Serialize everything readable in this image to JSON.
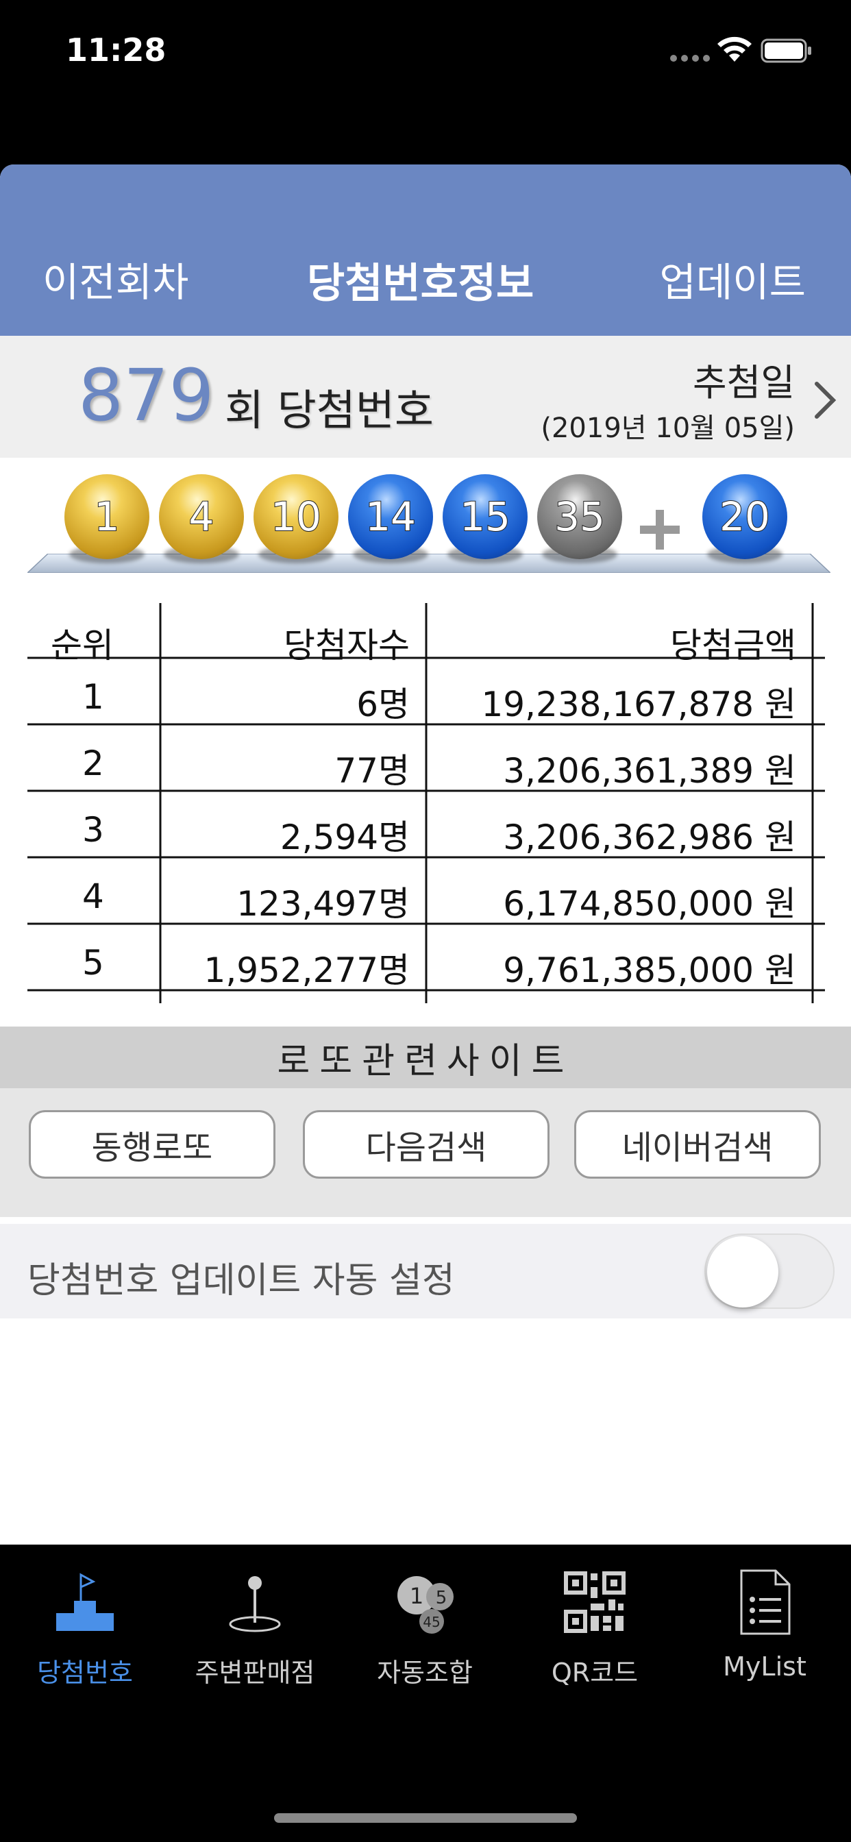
{
  "status": {
    "time": "11:28"
  },
  "nav": {
    "prev": "이전회차",
    "title": "당첨번호정보",
    "update": "업데이트"
  },
  "round": {
    "number": "879",
    "label": "회 당첨번호",
    "draw_label": "추첨일",
    "draw_date": "(2019년 10월 05일)"
  },
  "balls": [
    {
      "number": "1",
      "color": "yellow"
    },
    {
      "number": "4",
      "color": "yellow"
    },
    {
      "number": "10",
      "color": "yellow"
    },
    {
      "number": "14",
      "color": "blue"
    },
    {
      "number": "15",
      "color": "blue"
    },
    {
      "number": "35",
      "color": "gray"
    }
  ],
  "bonus_ball": {
    "number": "20",
    "color": "blue"
  },
  "table": {
    "headers": {
      "rank": "순위",
      "winners": "당첨자수",
      "amount": "당첨금액"
    },
    "rows": [
      {
        "rank": "1",
        "winners": "6명",
        "amount": "19,238,167,878 원"
      },
      {
        "rank": "2",
        "winners": "77명",
        "amount": "3,206,361,389 원"
      },
      {
        "rank": "3",
        "winners": "2,594명",
        "amount": "3,206,362,986 원"
      },
      {
        "rank": "4",
        "winners": "123,497명",
        "amount": "6,174,850,000 원"
      },
      {
        "rank": "5",
        "winners": "1,952,277명",
        "amount": "9,761,385,000 원"
      }
    ]
  },
  "sites": {
    "header": "로또관련사이트",
    "buttons": [
      "동행로또",
      "다음검색",
      "네이버검색"
    ]
  },
  "auto_update": {
    "label": "당첨번호 업데이트 자동 설정",
    "enabled": false
  },
  "tabs": [
    {
      "label": "당첨번호",
      "icon": "podium-flag-icon",
      "active": true
    },
    {
      "label": "주변판매점",
      "icon": "map-pin-icon",
      "active": false
    },
    {
      "label": "자동조합",
      "icon": "lotto-balls-icon",
      "active": false
    },
    {
      "label": "QR코드",
      "icon": "qr-code-icon",
      "active": false
    },
    {
      "label": "MyList",
      "icon": "document-list-icon",
      "active": false
    }
  ],
  "colors": {
    "nav_bg": "#6b87c2",
    "tab_active": "#4a90e8",
    "ball_yellow": "#e0b436",
    "ball_blue": "#1d63d6",
    "ball_gray": "#7a7a7a"
  }
}
